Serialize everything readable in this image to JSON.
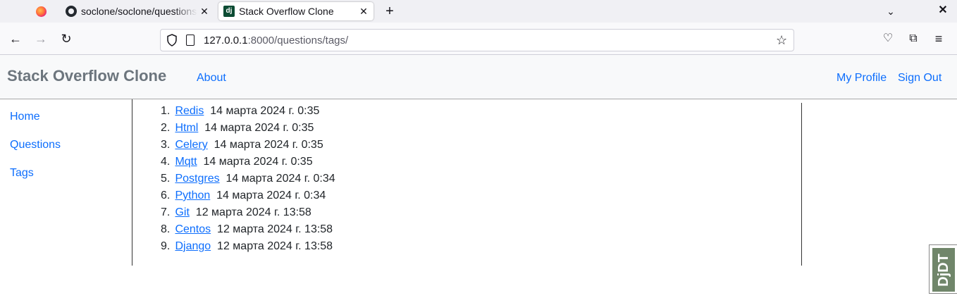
{
  "browser": {
    "tabs": [
      {
        "title": "soclone/soclone/questions",
        "icon": "github-icon"
      },
      {
        "title": "Stack Overflow Clone",
        "icon": "django-icon",
        "active": true
      }
    ],
    "close_glyph": "✕",
    "new_tab_glyph": "+",
    "tab_list_glyph": "⌄",
    "window_close_glyph": "✕",
    "url_host": "127.0.0.1",
    "url_rest": ":8000/questions/tags/",
    "back_glyph": "←",
    "forward_glyph": "→",
    "reload_glyph": "↻",
    "star_glyph": "☆",
    "pocket_glyph": "♡",
    "extensions_glyph": "⧉",
    "menu_glyph": "≡"
  },
  "header": {
    "brand": "Stack Overflow Clone",
    "about": "About",
    "my_profile": "My Profile",
    "sign_out": "Sign Out"
  },
  "sidebar": {
    "items": [
      {
        "label": "Home"
      },
      {
        "label": "Questions"
      },
      {
        "label": "Tags"
      }
    ]
  },
  "tags": [
    {
      "num": "1.",
      "name": "Redis",
      "date": "14 марта 2024 г. 0:35"
    },
    {
      "num": "2.",
      "name": "Html",
      "date": "14 марта 2024 г. 0:35"
    },
    {
      "num": "3.",
      "name": "Celery",
      "date": "14 марта 2024 г. 0:35"
    },
    {
      "num": "4.",
      "name": "Mqtt",
      "date": "14 марта 2024 г. 0:35"
    },
    {
      "num": "5.",
      "name": "Postgres",
      "date": "14 марта 2024 г. 0:34"
    },
    {
      "num": "6.",
      "name": "Python",
      "date": "14 марта 2024 г. 0:34"
    },
    {
      "num": "7.",
      "name": "Git",
      "date": "12 марта 2024 г. 13:58"
    },
    {
      "num": "8.",
      "name": "Centos",
      "date": "12 марта 2024 г. 13:58"
    },
    {
      "num": "9.",
      "name": "Django",
      "date": "12 марта 2024 г. 13:58"
    }
  ],
  "djdt": {
    "label": "DjDT"
  }
}
